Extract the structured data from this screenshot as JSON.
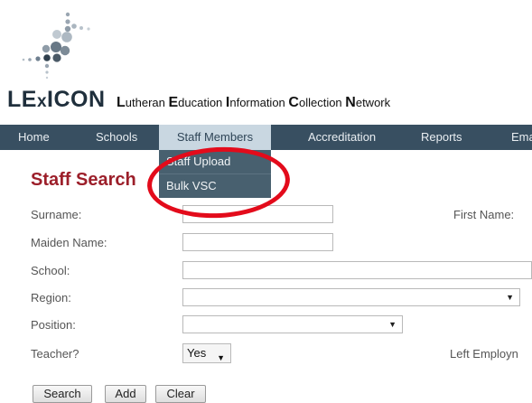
{
  "brand": {
    "name_big": "LE",
    "name_small": "x",
    "name_rest": "ICON",
    "subtitle_parts": [
      "L",
      "utheran ",
      "E",
      "ducation ",
      "I",
      "nformation ",
      "C",
      "ollection ",
      "N",
      "etwork"
    ]
  },
  "nav": {
    "items": [
      "Home",
      "Schools",
      "Staff Members",
      "Accreditation",
      "Reports",
      "Ema"
    ],
    "active": "Staff Members"
  },
  "dropdown": {
    "items": [
      "Staff Upload",
      "Bulk VSC"
    ]
  },
  "page": {
    "title": "Staff Search"
  },
  "form": {
    "surname_label": "Surname:",
    "first_name_label": "First Name:",
    "maiden_label": "Maiden Name:",
    "school_label": "School:",
    "region_label": "Region:",
    "position_label": "Position:",
    "teacher_label": "Teacher?",
    "teacher_value": "Yes",
    "left_employment_label": "Left Employn"
  },
  "buttons": {
    "search": "Search",
    "add": "Add",
    "clear": "Clear"
  },
  "colors": {
    "nav_bg": "#384f61",
    "nav_active": "#c9d7e1",
    "title_red": "#9c1f2a",
    "annotation_red": "#e30b1b"
  }
}
